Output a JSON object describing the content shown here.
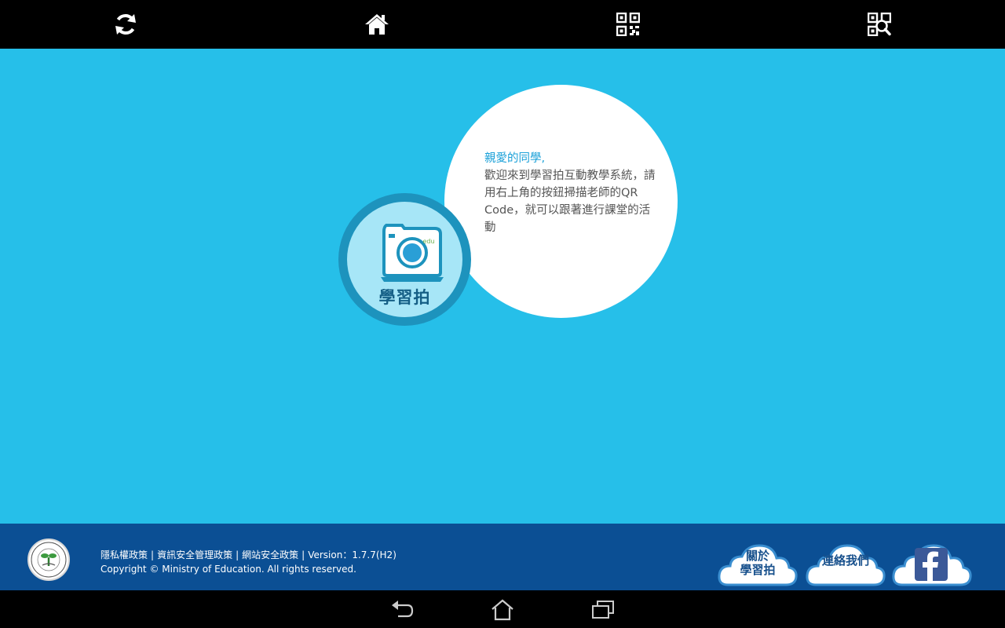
{
  "toolbar": {
    "icons": [
      "refresh-icon",
      "home-icon",
      "qr-code-icon",
      "qr-scan-icon"
    ]
  },
  "welcome": {
    "greeting": "親愛的同學,",
    "message": "歡迎來到學習拍互動教學系統，請用右上角的按鈕掃描老師的QR Code，就可以跟著進行課堂的活動"
  },
  "app_logo": {
    "name": "學習拍",
    "badge": "edu"
  },
  "footer": {
    "links": [
      "隱私權政策",
      "資訊安全管理政策",
      "網站安全政策"
    ],
    "version": "Version：1.7.7(H2)",
    "copyright": "Copyright © Ministry of Education. All rights reserved.",
    "about_button": {
      "line1": "關於",
      "line2": "學習拍"
    },
    "contact_button": "連絡我們",
    "facebook_icon": "facebook-icon",
    "seal_text": "MINISTRY OF EDUCATION",
    "seal_chinese": "教育部"
  },
  "colors": {
    "main_background": "#26bfe9",
    "footer_background": "#0b4f94",
    "accent": "#1aa0d8"
  },
  "system_nav": {
    "icons": [
      "back-icon",
      "home-icon",
      "recent-apps-icon"
    ]
  }
}
